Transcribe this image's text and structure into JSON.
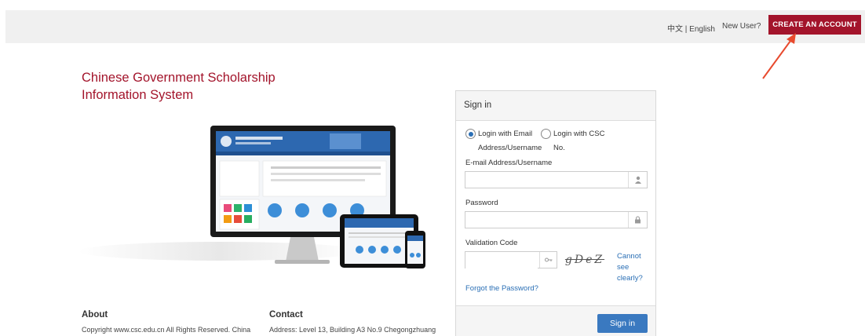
{
  "header": {
    "lang_zh": "中文",
    "lang_sep": " | ",
    "lang_en": "English",
    "new_user": "New User?",
    "create_account": "CREATE AN ACCOUNT"
  },
  "site": {
    "title_line1": "Chinese Government Scholarship",
    "title_line2": "Information System"
  },
  "signin": {
    "heading": "Sign in",
    "option_email_line1": "Login with Email",
    "option_email_line2": "Address/Username",
    "option_csc_line1": "Login with CSC",
    "option_csc_line2": "No.",
    "selected_option": "email",
    "email_label": "E-mail Address/Username",
    "email_value": "",
    "password_label": "Password",
    "password_value": "",
    "validation_label": "Validation Code",
    "validation_value": "",
    "captcha_text": "gDeZ",
    "cannot_see": "Cannot see clearly?",
    "forgot": "Forgot the Password?",
    "submit": "Sign in"
  },
  "footer": {
    "about_title": "About",
    "about_text": "Copyright www.csc.edu.cn All Rights Reserved. China",
    "contact_title": "Contact",
    "contact_text": "Address: Level 13, Building A3 No.9 Chegongzhuang"
  },
  "colors": {
    "brand": "#a3142b",
    "link": "#2a6fb5",
    "button": "#3a79c0"
  }
}
